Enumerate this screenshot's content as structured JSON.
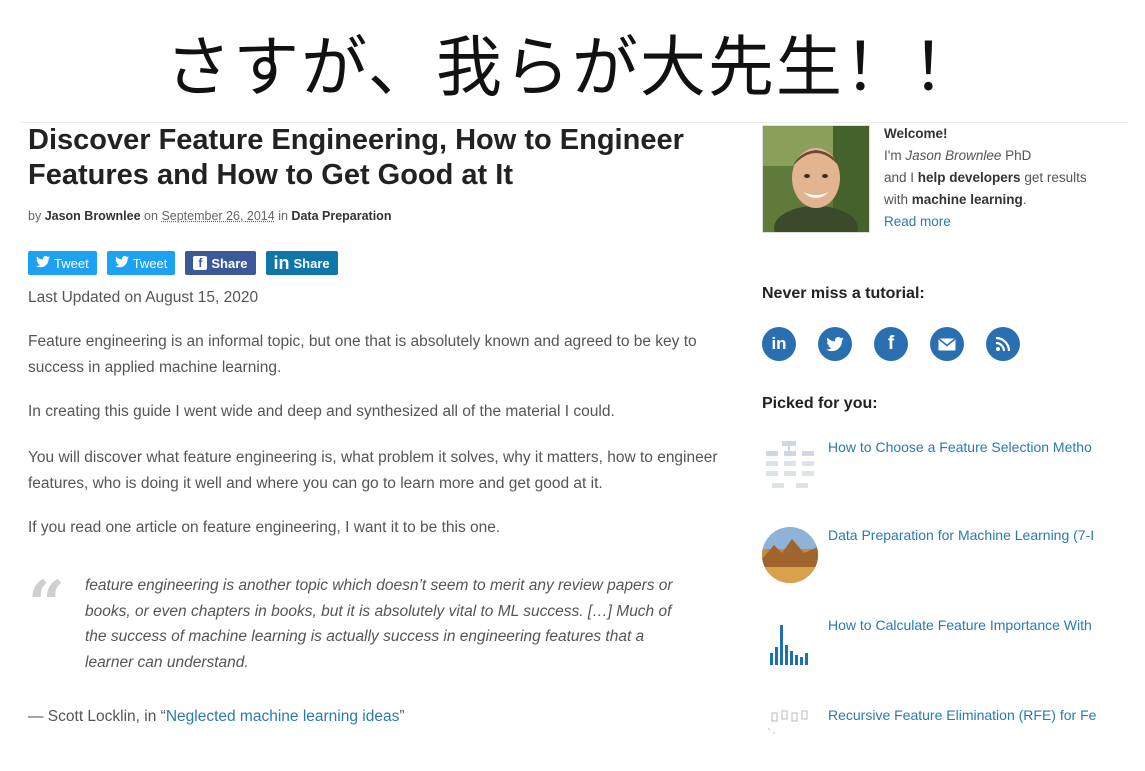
{
  "banner": {
    "text": "さすが、我らが大先生！！"
  },
  "article": {
    "title": "Discover Feature Engineering, How to Engineer Features and How to Get Good at It",
    "byline": {
      "by": "by",
      "author": "Jason Brownlee",
      "on": "on",
      "date": "September 26, 2014",
      "in": "in",
      "category": "Data Preparation"
    },
    "share_buttons": [
      {
        "label": "Tweet",
        "icon": "twitter-bird-icon"
      },
      {
        "label": "Tweet",
        "icon": "twitter-bird-icon"
      },
      {
        "label": "Share",
        "icon": "facebook-icon"
      },
      {
        "label": "Share",
        "icon": "linkedin-icon"
      }
    ],
    "updated": "Last Updated on August 15, 2020",
    "paragraphs": [
      "Feature engineering is an informal topic, but one that is absolutely known and agreed to be key to success in applied machine learning.",
      "In creating this guide I went wide and deep and synthesized all of the material I could.",
      "You will discover what feature engineering is, what problem it solves, why it matters, how to engineer features, who is doing it well and where you can go to learn more and get good at it.",
      "If you read one article on feature engineering, I want it to be this one."
    ],
    "quote": "feature engineering is another topic which doesn’t seem to merit any review papers or books, or even chapters in books, but it is absolutely vital to ML success. […] Much of the success of machine learning is actually success in engineering features that a learner can understand.",
    "citation": {
      "prefix": "— Scott Locklin, in “",
      "link": "Neglected machine learning ideas",
      "suffix": "”"
    }
  },
  "sidebar": {
    "welcome": {
      "heading": "Welcome!",
      "im": "I'm ",
      "name": "Jason Brownlee",
      "phd": " PhD",
      "and_i": "and I ",
      "help": "help developers",
      "get_results": " get results",
      "with": "with ",
      "ml": "machine learning",
      "period": ".",
      "read_more": "Read more"
    },
    "never_miss": "Never miss a tutorial:",
    "social_icons": [
      "linkedin-icon",
      "twitter-icon",
      "facebook-icon",
      "email-icon",
      "rss-icon"
    ],
    "picked_heading": "Picked for you:",
    "picked": [
      {
        "title": "How to Choose a Feature Selection Metho",
        "thumb": "diagram-thumb"
      },
      {
        "title": "Data Preparation for Machine Learning (7-I",
        "thumb": "landscape-thumb"
      },
      {
        "title": "How to Calculate Feature Importance With",
        "thumb": "barchart-thumb"
      },
      {
        "title": "Recursive Feature Elimination (RFE) for Fe",
        "thumb": "boxplot-thumb"
      }
    ]
  },
  "colors": {
    "link": "#2a7ab0",
    "twitter": "#1da1f2",
    "facebook": "#3b5998",
    "linkedin": "#0e76a8",
    "social_circle": "#2a6fb0"
  }
}
